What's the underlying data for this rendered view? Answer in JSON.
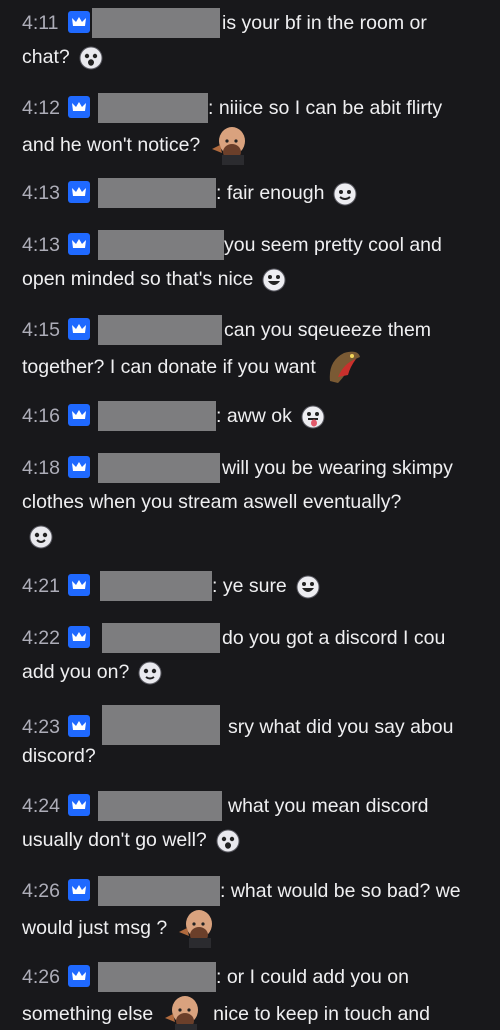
{
  "chat": {
    "messages": [
      {
        "time": "4:11",
        "text1": "is your bf in the room or",
        "text2": "chat?",
        "emote": "ghost-face-emote",
        "emote_line": 2
      },
      {
        "time": "4:12",
        "text1": ": niiice so I can be abit flirty",
        "text2": "and he won't notice?",
        "emote": "bald-man-emote",
        "emote_line": 2
      },
      {
        "time": "4:13",
        "text1": ": fair enough",
        "text2": "",
        "emote": "smile-face-emote",
        "emote_line": 1
      },
      {
        "time": "4:13",
        "text1": "you seem pretty cool and",
        "text2": "open minded so that's nice",
        "emote": "grin-face-emote",
        "emote_line": 2
      },
      {
        "time": "4:15",
        "text1": "can you sqeueeze them",
        "text2": "together? I can donate if you want",
        "emote": "creature-emote",
        "emote_line": 2
      },
      {
        "time": "4:16",
        "text1": ": aww ok",
        "text2": "",
        "emote": "tongue-face-emote",
        "emote_line": 1
      },
      {
        "time": "4:18",
        "text1": "will you be wearing skimpy",
        "text2": "clothes when you stream aswell eventually?",
        "text3": "",
        "emote": "ghost-face-emote",
        "emote_line": 3
      },
      {
        "time": "4:21",
        "text1": ": ye sure",
        "text2": "",
        "emote": "grin-face-emote",
        "emote_line": 1
      },
      {
        "time": "4:22",
        "text1": "do you got a discord I cou",
        "text2": "add you on?",
        "emote": "ghost-face-emote",
        "emote_line": 2
      },
      {
        "time": "4:23",
        "text1": "sry what did you say abou",
        "text2": "discord?",
        "emote": "",
        "emote_line": 0
      },
      {
        "time": "4:24",
        "text1": "what you mean discord",
        "text2": "usually don't go well?",
        "emote": "ghost-face-emote",
        "emote_line": 2
      },
      {
        "time": "4:26",
        "text1": ": what would be so bad? we",
        "text2": "would just msg ?",
        "emote": "bald-man-emote",
        "emote_line": 2
      },
      {
        "time": "4:26",
        "text1": ": or I could add you on",
        "text2": "something else",
        "text2b": "nice to keep in touch and",
        "emote": "bald-man-emote",
        "emote_line": 2
      }
    ]
  },
  "colors": {
    "background": "#18181b",
    "text": "#efeff1",
    "timestamp": "#adadb8",
    "badge": "#1f69ff",
    "redaction": "#7d7d7f"
  }
}
